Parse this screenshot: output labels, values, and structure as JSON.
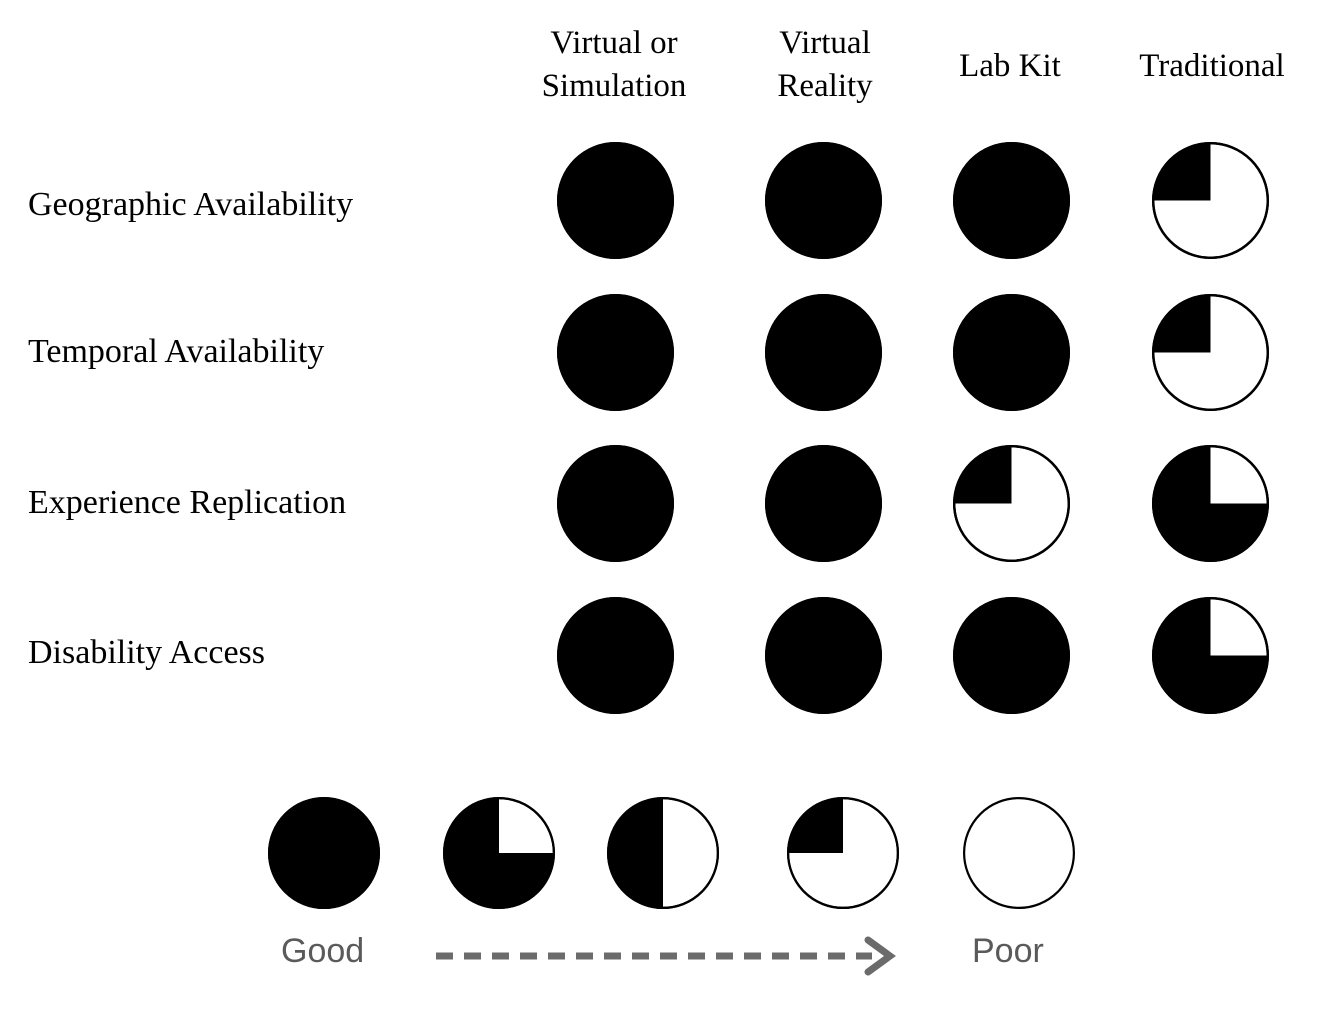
{
  "figure": {
    "type": "harvey-ball-matrix",
    "title": "",
    "background_color": "#ffffff",
    "fill_color": "#000000",
    "outline_color": "#000000",
    "legend_text_color": "#5a5a5a",
    "arrow_color": "#6b6b6b"
  },
  "columns": [
    {
      "label": "Virtual or\nSimulation",
      "label_line1": "Virtual or",
      "label_line2": "Simulation"
    },
    {
      "label": "Virtual\nReality",
      "label_line1": "Virtual",
      "label_line2": "Reality"
    },
    {
      "label": "Lab Kit",
      "label_line1": "Lab Kit",
      "label_line2": ""
    },
    {
      "label": "Traditional",
      "label_line1": "Traditional",
      "label_line2": ""
    }
  ],
  "rows": [
    {
      "label": "Geographic Availability"
    },
    {
      "label": "Temporal Availability"
    },
    {
      "label": "Experience Replication"
    },
    {
      "label": "Disability Access"
    }
  ],
  "legend": {
    "good_label": "Good",
    "poor_label": "Poor",
    "arrow_style": "dashed-right-arrow",
    "steps": [
      {
        "fill_percent": 100,
        "meaning": "Good"
      },
      {
        "fill_percent": 75,
        "meaning": ""
      },
      {
        "fill_percent": 50,
        "meaning": ""
      },
      {
        "fill_percent": 25,
        "meaning": ""
      },
      {
        "fill_percent": 0,
        "meaning": "Poor"
      }
    ]
  },
  "chart_data": {
    "type": "heatmap",
    "title": "",
    "xlabel": "",
    "ylabel": "",
    "notation": "Harvey balls: percent of circle filled black, measured counterclockwise from the 12 o'clock position. Higher fill = better.",
    "scale_min": 0,
    "scale_max": 100,
    "scale_units": "percent filled",
    "categories": [
      "Virtual or Simulation",
      "Virtual Reality",
      "Lab Kit",
      "Traditional"
    ],
    "row_categories": [
      "Geographic Availability",
      "Temporal Availability",
      "Experience Replication",
      "Disability Access"
    ],
    "values": [
      [
        100,
        100,
        100,
        25
      ],
      [
        100,
        100,
        100,
        25
      ],
      [
        100,
        100,
        25,
        75
      ],
      [
        100,
        100,
        100,
        75
      ]
    ],
    "series": [
      {
        "name": "Geographic Availability",
        "values": [
          100,
          100,
          100,
          25
        ]
      },
      {
        "name": "Temporal Availability",
        "values": [
          100,
          100,
          100,
          25
        ]
      },
      {
        "name": "Experience Replication",
        "values": [
          100,
          100,
          25,
          75
        ]
      },
      {
        "name": "Disability Access",
        "values": [
          100,
          100,
          100,
          75
        ]
      }
    ],
    "legend_entries": [
      "Good",
      "Poor"
    ],
    "legend_position": "bottom",
    "grid": false
  }
}
